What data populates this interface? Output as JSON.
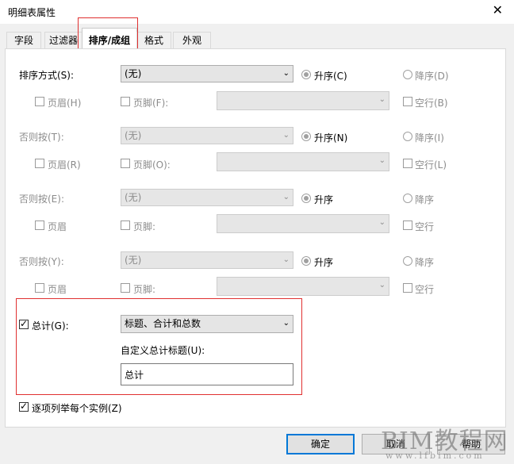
{
  "window": {
    "title": "明细表属性",
    "close_glyph": "✕"
  },
  "tabs": [
    "字段",
    "过滤器",
    "排序/成组",
    "格式",
    "外观"
  ],
  "sort_groups": [
    {
      "label": "排序方式(S):",
      "select": "(无)",
      "asc": "升序(C)",
      "desc": "降序(D)",
      "header": "页眉(H)",
      "footer": "页脚(F):",
      "blank": "空行(B)"
    },
    {
      "label": "否则按(T):",
      "select": "(无)",
      "asc": "升序(N)",
      "desc": "降序(I)",
      "header": "页眉(R)",
      "footer": "页脚(O):",
      "blank": "空行(L)"
    },
    {
      "label": "否则按(E):",
      "select": "(无)",
      "asc": "升序",
      "desc": "降序",
      "header": "页眉",
      "footer": "页脚:",
      "blank": "空行"
    },
    {
      "label": "否则按(Y):",
      "select": "(无)",
      "asc": "升序",
      "desc": "降序",
      "header": "页眉",
      "footer": "页脚:",
      "blank": "空行"
    }
  ],
  "grand_total": {
    "label": "总计(G):",
    "select": "标题、合计和总数",
    "custom_title_label": "自定义总计标题(U):",
    "custom_title_value": "总计"
  },
  "itemize_label": "逐项列举每个实例(Z)",
  "buttons": {
    "ok": "确定",
    "cancel": "取消",
    "help": "帮助"
  },
  "watermark": {
    "text": "BIM教程网",
    "url": "www.lfbim.com"
  },
  "colors": {
    "highlight": "#e03030",
    "focus": "#0078d7"
  }
}
